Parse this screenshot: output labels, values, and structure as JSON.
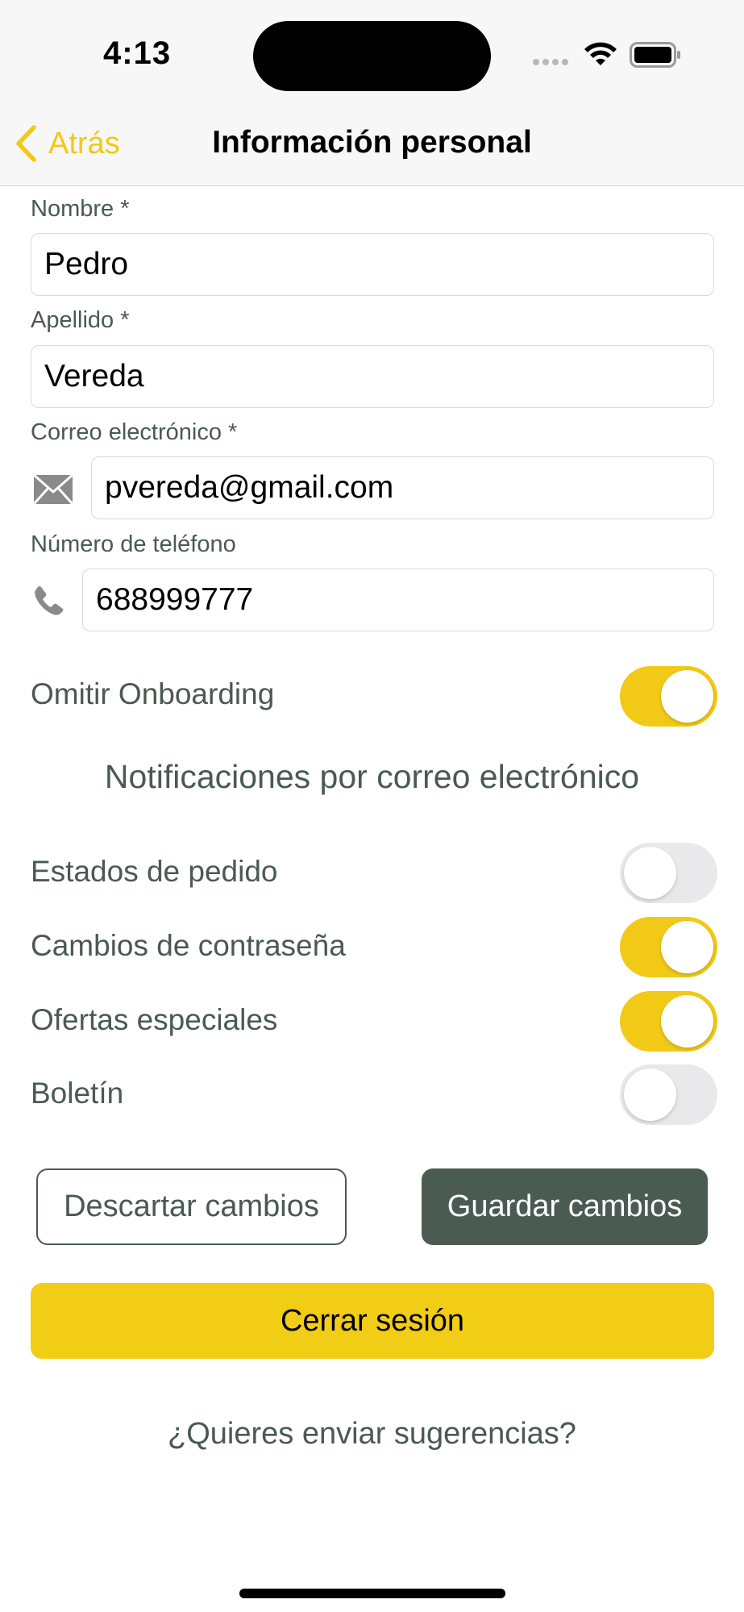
{
  "status_bar": {
    "time": "4:13"
  },
  "nav": {
    "back_label": "Atrás",
    "title": "Información personal"
  },
  "form": {
    "first_name": {
      "label": "Nombre *",
      "value": "Pedro"
    },
    "last_name": {
      "label": "Apellido *",
      "value": "Vereda"
    },
    "email": {
      "label": "Correo electrónico *",
      "value": "pvereda@gmail.com",
      "icon": "envelope-icon"
    },
    "phone": {
      "label": "Número de teléfono",
      "value": "688999777",
      "icon": "phone-icon"
    }
  },
  "onboarding": {
    "label": "Omitir Onboarding",
    "enabled": true
  },
  "notifications": {
    "heading": "Notificaciones por correo electrónico",
    "items": [
      {
        "label": "Estados de pedido",
        "enabled": false
      },
      {
        "label": "Cambios de contraseña",
        "enabled": true
      },
      {
        "label": "Ofertas especiales",
        "enabled": true
      },
      {
        "label": "Boletín",
        "enabled": false
      }
    ]
  },
  "actions": {
    "discard_label": "Descartar cambios",
    "save_label": "Guardar cambios",
    "logout_label": "Cerrar sesión",
    "suggestions_label": "¿Quieres enviar sugerencias?"
  },
  "colors": {
    "accent_yellow": "#f2c916",
    "primary_dark": "#4a5c52",
    "text_muted": "#4a5a50"
  }
}
